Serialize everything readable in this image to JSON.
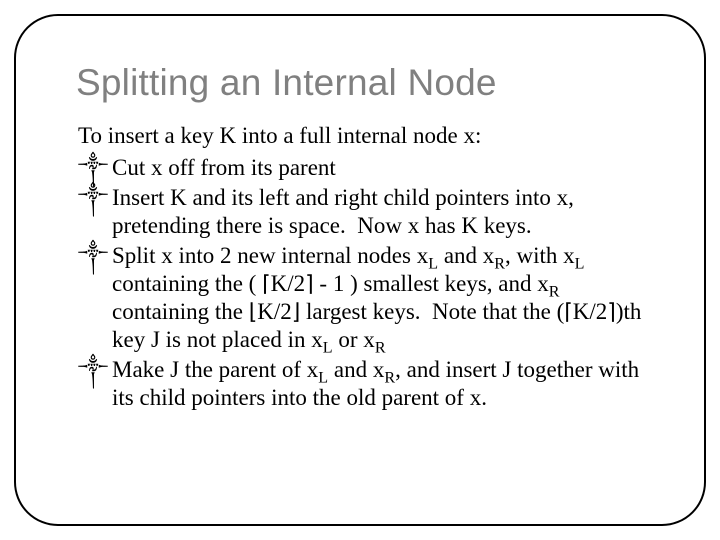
{
  "title": "Splitting an Internal Node",
  "lead": "To insert a key K into a full internal node x:",
  "bullet_glyph": "༒",
  "items": {
    "b1": "Cut x off from its parent",
    "b2": "Insert K and its left and right child pointers into x, pretending there is space.  Now x has K keys.",
    "b3": {
      "p1": "Split x into 2 new internal nodes x",
      "sL": "L",
      "p2": " and x",
      "sR": "R",
      "p3": ", with x",
      "p4": " containing the ( ",
      "ceilL": "⌈",
      "k2a": "K/2",
      "ceilR": "⌉",
      "p5": " - 1 ) smallest keys, and x",
      "p6": " containing the ",
      "floorL": "⌊",
      "k2b": "K/2",
      "floorR": "⌋",
      "p7": " largest keys.  Note that the (",
      "k2c": "K/2",
      "p8": ")th key J is not placed in x",
      "p9": " or x"
    },
    "b4": {
      "p1": "Make J the parent of x",
      "sL": "L",
      "p2": " and x",
      "sR": "R",
      "p3": ", and insert J together with its child pointers into the old parent of x."
    }
  }
}
